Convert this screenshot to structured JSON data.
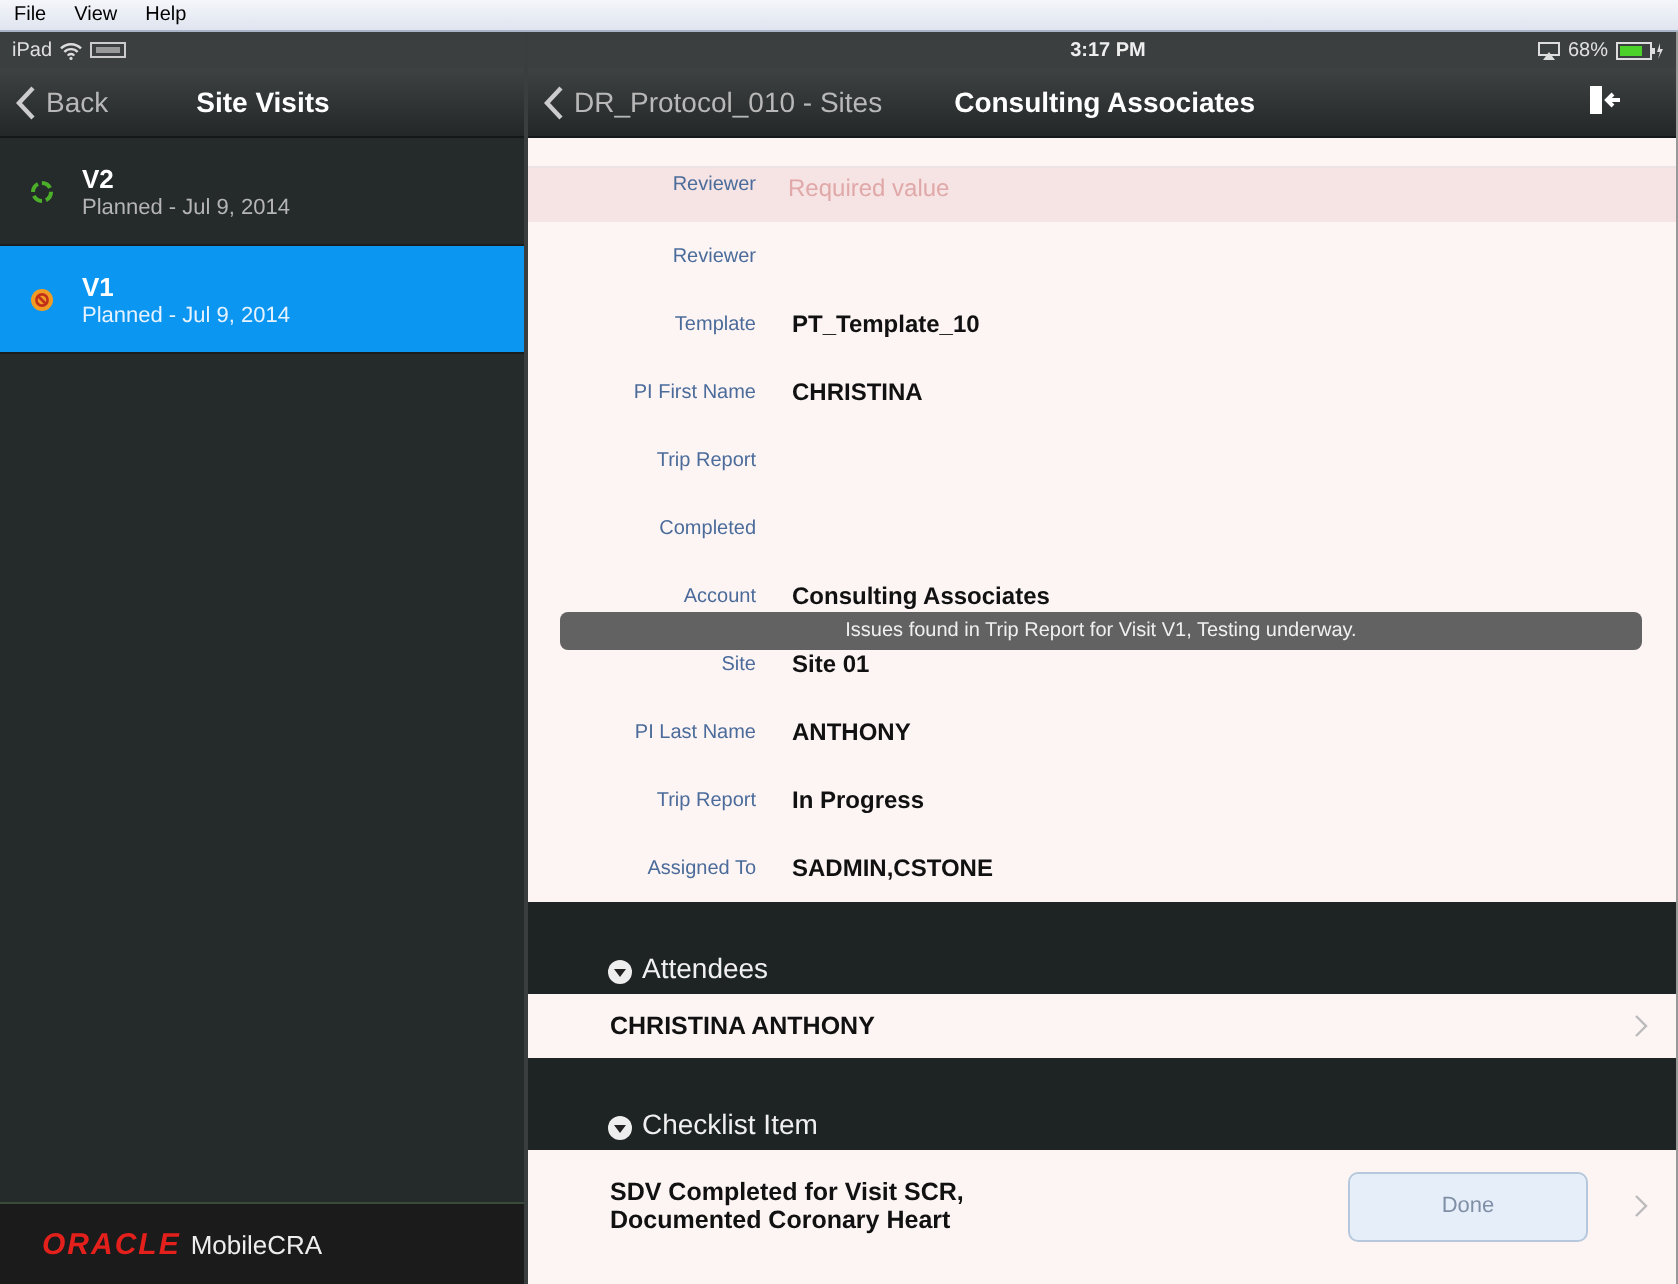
{
  "menu_bar": [
    "File",
    "View",
    "Help"
  ],
  "status_bar": {
    "device": "iPad",
    "time": "3:17 PM",
    "battery": "68%"
  },
  "sidebar": {
    "back": "Back",
    "title": "Site Visits",
    "visits": [
      {
        "name": "V2",
        "subtitle": "Planned - Jul 9, 2014",
        "kind": "in_progress",
        "selected": false
      },
      {
        "name": "V1",
        "subtitle": "Planned - Jul 9, 2014",
        "kind": "issue",
        "selected": true
      }
    ],
    "footer": {
      "brand": "ORACLE",
      "product": "MobileCRA"
    }
  },
  "detail": {
    "back": "DR_Protocol_010 - Sites",
    "title": "Consulting Associates",
    "fields": [
      {
        "label": "Reviewer",
        "placeholder": "Required value",
        "invalid": true
      },
      {
        "label": "Reviewer",
        "invalid": false
      },
      {
        "label": "Template",
        "value": "PT_Template_10",
        "invalid": false
      },
      {
        "label": "PI First Name",
        "value": "CHRISTINA",
        "invalid": false
      },
      {
        "label": "Trip Report",
        "invalid": false
      },
      {
        "label": "Completed",
        "invalid": false
      },
      {
        "label": "Account",
        "value": "Consulting Associates",
        "invalid": false
      },
      {
        "label": "Site",
        "value": "Site 01",
        "invalid": false
      },
      {
        "label": "PI Last Name",
        "value": "ANTHONY",
        "invalid": false
      },
      {
        "label": "Trip Report",
        "value": "In Progress",
        "invalid": false
      },
      {
        "label": "Assigned To",
        "value": "SADMIN,CSTONE",
        "invalid": false
      }
    ],
    "sections": [
      {
        "title": "Attendees",
        "expanded": true,
        "items": [
          {
            "text": "CHRISTINA ANTHONY"
          }
        ]
      },
      {
        "title": "Checklist Item",
        "expanded": true,
        "items": [
          {
            "text": "SDV Completed for Visit SCR, Documented Coronary Heart",
            "button": {
              "label": "Done",
              "disabled": true
            }
          }
        ]
      }
    ],
    "toast": "Issues found in Trip Report for Visit V1, Testing underway."
  }
}
